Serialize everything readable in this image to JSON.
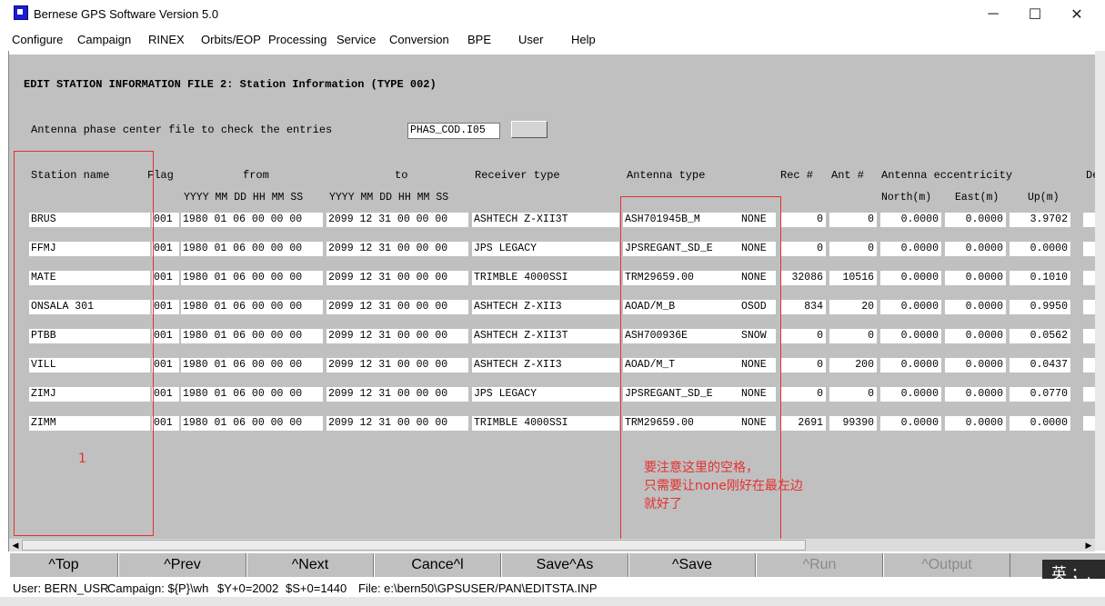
{
  "window": {
    "title": "Bernese GPS Software Version 5.0",
    "minimize": "─",
    "maximize": "☐",
    "close": "✕"
  },
  "menu": [
    "Configure",
    "Campaign",
    "RINEX",
    "Orbits/EOP",
    "Processing",
    "Service",
    "Conversion",
    "BPE",
    "User",
    "Help"
  ],
  "panel": {
    "heading": "EDIT STATION INFORMATION FILE 2: Station Information (TYPE 002)",
    "phase_label": "Antenna phase center file to check the entries",
    "phase_value": "PHAS_COD.I05"
  },
  "headers": {
    "station_name": "Station name",
    "flag": "Flag",
    "from": "from",
    "to": "to",
    "receiver_type": "Receiver type",
    "antenna_type": "Antenna type",
    "rec_num": "Rec #",
    "ant_num": "Ant #",
    "ecc": "Antenna eccentricity",
    "de": "De",
    "date_sub": "YYYY MM DD HH MM SS",
    "north": "North(m)",
    "east": "East(m)",
    "up": "Up(m)"
  },
  "rows": [
    {
      "name": "BRUS",
      "flag": "001",
      "from": "1980 01 06 00 00 00",
      "to": "2099 12 31 00 00 00",
      "receiver": "ASHTECH Z-XII3T",
      "antenna": "ASH701945B_M",
      "radome": "NONE",
      "rec": "0",
      "ant": "0",
      "north": "0.0000",
      "east": "0.0000",
      "up": "3.9702"
    },
    {
      "name": "FFMJ",
      "flag": "001",
      "from": "1980 01 06 00 00 00",
      "to": "2099 12 31 00 00 00",
      "receiver": "JPS LEGACY",
      "antenna": "JPSREGANT_SD_E",
      "radome": "NONE",
      "rec": "0",
      "ant": "0",
      "north": "0.0000",
      "east": "0.0000",
      "up": "0.0000"
    },
    {
      "name": "MATE",
      "flag": "001",
      "from": "1980 01 06 00 00 00",
      "to": "2099 12 31 00 00 00",
      "receiver": "TRIMBLE 4000SSI",
      "antenna": "TRM29659.00",
      "radome": "NONE",
      "rec": "32086",
      "ant": "10516",
      "north": "0.0000",
      "east": "0.0000",
      "up": "0.1010"
    },
    {
      "name": "ONSALA 301",
      "flag": "001",
      "from": "1980 01 06 00 00 00",
      "to": "2099 12 31 00 00 00",
      "receiver": "ASHTECH Z-XII3",
      "antenna": "AOAD/M_B",
      "radome": "OSOD",
      "rec": "834",
      "ant": "20",
      "north": "0.0000",
      "east": "0.0000",
      "up": "0.9950"
    },
    {
      "name": "PTBB",
      "flag": "001",
      "from": "1980 01 06 00 00 00",
      "to": "2099 12 31 00 00 00",
      "receiver": "ASHTECH Z-XII3T",
      "antenna": "ASH700936E",
      "radome": "SNOW",
      "rec": "0",
      "ant": "0",
      "north": "0.0000",
      "east": "0.0000",
      "up": "0.0562"
    },
    {
      "name": "VILL",
      "flag": "001",
      "from": "1980 01 06 00 00 00",
      "to": "2099 12 31 00 00 00",
      "receiver": "ASHTECH Z-XII3",
      "antenna": "AOAD/M_T",
      "radome": "NONE",
      "rec": "0",
      "ant": "200",
      "north": "0.0000",
      "east": "0.0000",
      "up": "0.0437"
    },
    {
      "name": "ZIMJ",
      "flag": "001",
      "from": "1980 01 06 00 00 00",
      "to": "2099 12 31 00 00 00",
      "receiver": "JPS LEGACY",
      "antenna": "JPSREGANT_SD_E",
      "radome": "NONE",
      "rec": "0",
      "ant": "0",
      "north": "0.0000",
      "east": "0.0000",
      "up": "0.0770"
    },
    {
      "name": "ZIMM",
      "flag": "001",
      "from": "1980 01 06 00 00 00",
      "to": "2099 12 31 00 00 00",
      "receiver": "TRIMBLE 4000SSI",
      "antenna": "TRM29659.00",
      "radome": "NONE",
      "rec": "2691",
      "ant": "99390",
      "north": "0.0000",
      "east": "0.0000",
      "up": "0.0000"
    }
  ],
  "buttons": [
    {
      "label": "^Top",
      "enabled": true
    },
    {
      "label": "^Prev",
      "enabled": true
    },
    {
      "label": "^Next",
      "enabled": true
    },
    {
      "label": "Cance^l",
      "enabled": true
    },
    {
      "label": "Save^As",
      "enabled": true
    },
    {
      "label": "^Save",
      "enabled": true
    },
    {
      "label": "^Run",
      "enabled": false
    },
    {
      "label": "^Output",
      "enabled": false
    }
  ],
  "status": {
    "user": "User: BERN_USR",
    "campaign": "Campaign: ${P}\\wh",
    "year": "$Y+0=2002",
    "session": "$S+0=1440",
    "file": "File: e:\\bern50\\GPSUSER/PAN\\EDITSTA.INP"
  },
  "ime": "英 ；,",
  "annotations": {
    "label1": "1",
    "note_line1": "要注意这里的空格，",
    "note_line2": "只需要让none刚好在最左边",
    "note_line3": "就好了",
    "color": "#e53030"
  },
  "colors": {
    "panel": "#c0c0c0",
    "field": "#ffffff",
    "annotation": "#e53030"
  }
}
